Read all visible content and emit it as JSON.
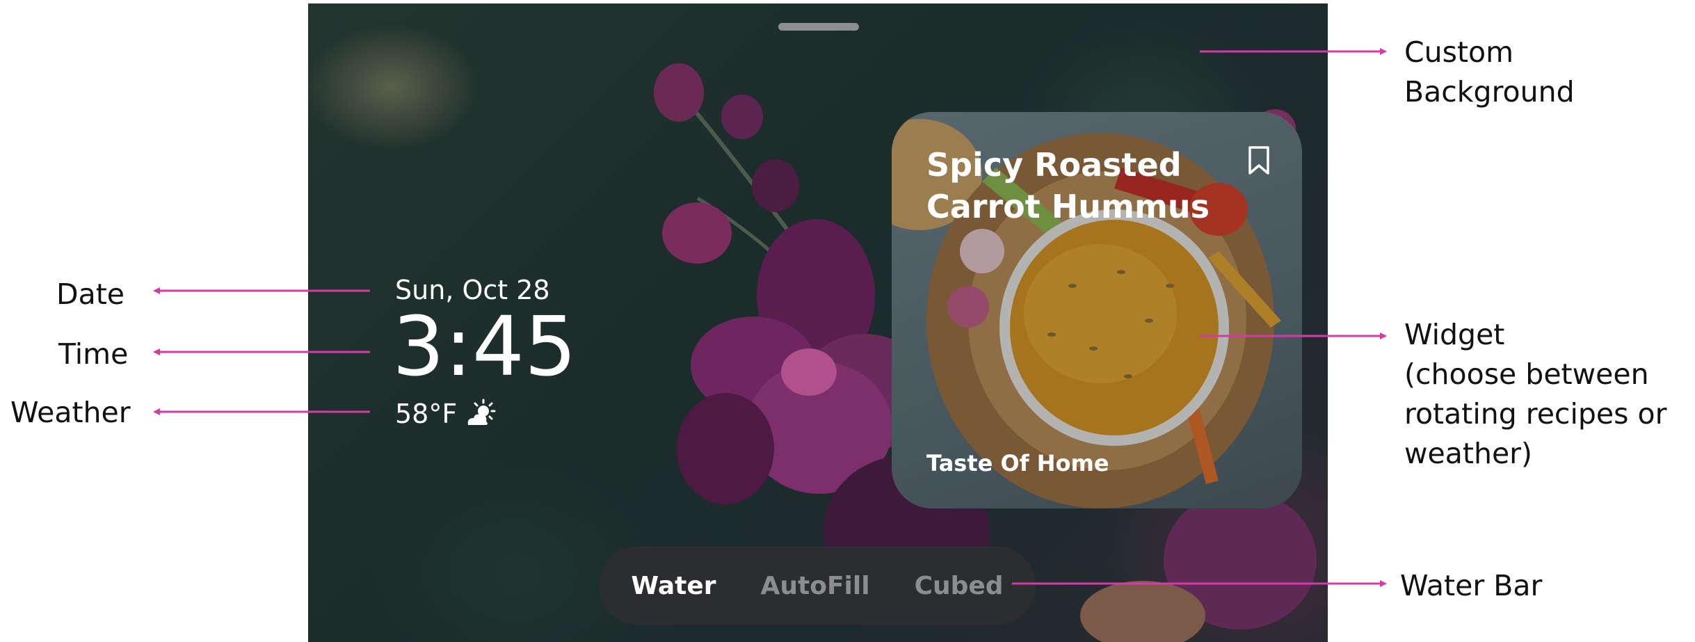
{
  "clock": {
    "date": "Sun, Oct 28",
    "time": "3:45",
    "weather": "58°F",
    "weather_icon": "partly-sunny-icon"
  },
  "widget": {
    "title_line1": "Spicy Roasted",
    "title_line2": "Carrot Hummus",
    "source": "Taste Of Home",
    "bookmark_icon": "bookmark-icon"
  },
  "water_bar": {
    "items": [
      {
        "label": "Water",
        "active": true
      },
      {
        "label": "AutoFill",
        "active": false
      },
      {
        "label": "Cubed",
        "active": false
      }
    ]
  },
  "annotations": {
    "custom_background": [
      "Custom",
      "Background"
    ],
    "date": "Date",
    "time": "Time",
    "weather": "Weather",
    "widget": [
      "Widget",
      "(choose between",
      "rotating recipes or",
      "weather)"
    ],
    "water_bar": "Water Bar"
  },
  "colors": {
    "annotation_arrow": "#d63aa8",
    "water_bar_bg": "#2c2d31",
    "inactive_text": "#8c8d90"
  }
}
